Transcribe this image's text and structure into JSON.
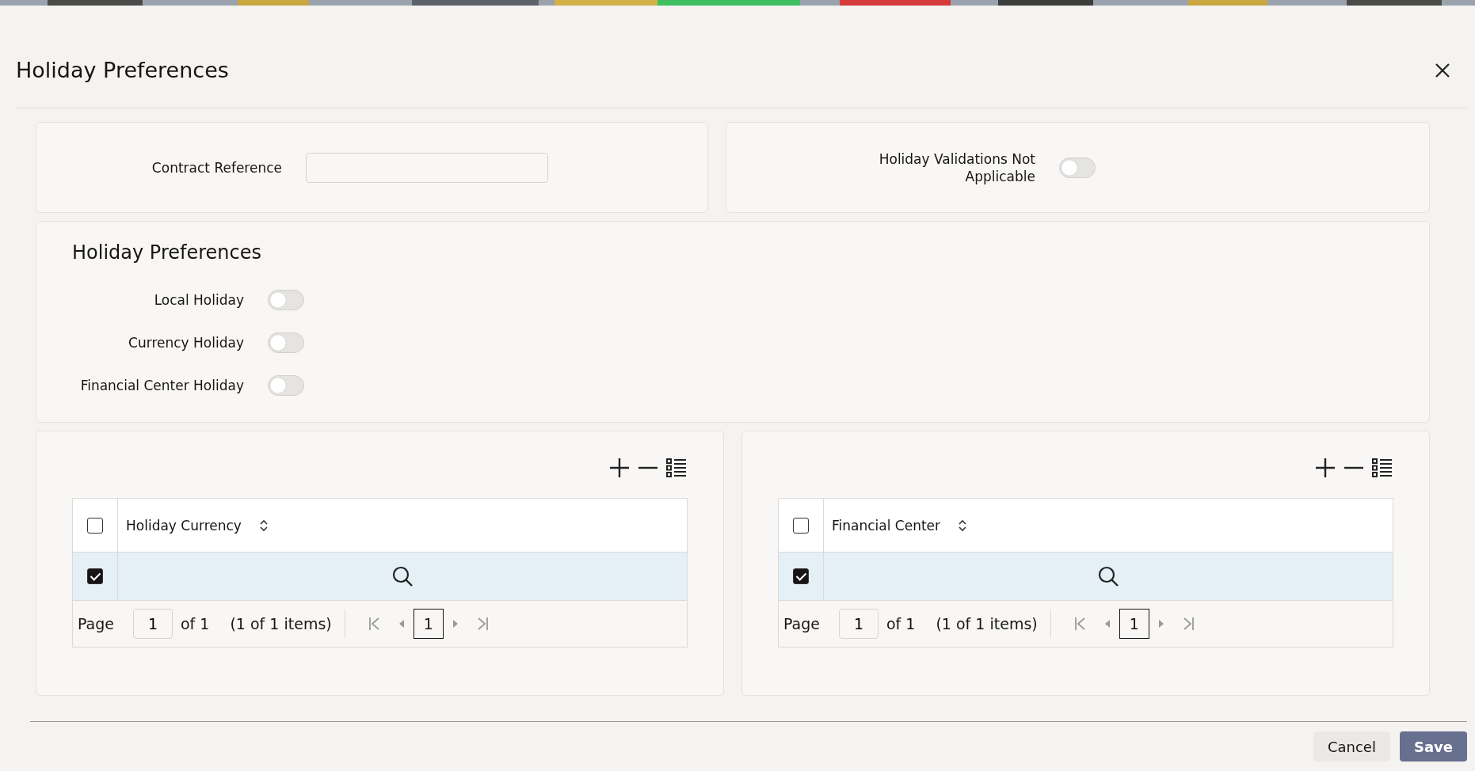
{
  "dialog": {
    "title": "Holiday Preferences"
  },
  "contract_reference": {
    "label": "Contract Reference"
  },
  "holiday_validations": {
    "label": "Holiday Validations Not Applicable",
    "on": false
  },
  "preferences": {
    "title": "Holiday Preferences",
    "toggles": [
      {
        "label": "Local Holiday",
        "on": false
      },
      {
        "label": "Currency Holiday",
        "on": false
      },
      {
        "label": "Financial Center Holiday",
        "on": false
      }
    ]
  },
  "grids": [
    {
      "column": "Holiday Currency",
      "header_checked": false,
      "row_checked": true,
      "pager": {
        "page_label": "Page",
        "page": "1",
        "of": "of 1",
        "items": "(1 of 1 items)",
        "current": "1"
      }
    },
    {
      "column": "Financial Center",
      "header_checked": false,
      "row_checked": true,
      "pager": {
        "page_label": "Page",
        "page": "1",
        "of": "of 1",
        "items": "(1 of 1 items)",
        "current": "1"
      }
    }
  ],
  "buttons": [
    {
      "label": "Cancel",
      "kind": "secondary"
    },
    {
      "label": "Save",
      "kind": "primary"
    }
  ]
}
